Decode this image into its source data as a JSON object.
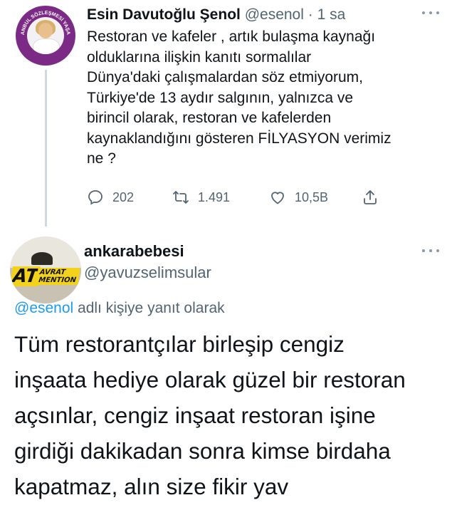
{
  "tweet1": {
    "author_name": "Esin Davutoğlu Şenol",
    "handle": "@esenol",
    "separator": "·",
    "time": "1 sa",
    "text": "Restoran ve kafeler , artık bulaşma kaynağı\nolduklarına ilişkin kanıtı sormalılar\nDünya'daki çalışmalardan söz etmiyorum,\nTürkiye'de 13 aydır salgının, yalnızca ve\nbirincil olarak, restoran ve kafelerden\nkaynaklandığını gösteren FİLYASYON verimiz\nne ?",
    "avatar_ring_text": "İSTANBUL SÖZLEŞMESİ YAŞATIR",
    "actions": {
      "reply_icon": "reply-icon",
      "reply_count": "202",
      "retweet_icon": "retweet-icon",
      "retweet_count": "1.491",
      "like_icon": "like-icon",
      "like_count": "10,5B",
      "share_icon": "share-icon"
    }
  },
  "tweet2": {
    "author_name": "ankarabebesi",
    "handle": "@yavuzselimsular",
    "avatar_logo_big": "AT",
    "avatar_logo_small_1": "AVRAT",
    "avatar_logo_small_2": "MENTION",
    "reply_to_handle": "@esenol",
    "reply_to_suffix": " adlı kişiye yanıt olarak",
    "text": "Tüm restorantçılar birleşip cengiz\ninşaata hediye olarak güzel bir restoran\naçsınlar, cengiz inşaat restoran işine\ngirdiği dakikadan sonra kimse birdaha\nkapatmaz, alın size fikir yav"
  },
  "colors": {
    "text": "#0f1419",
    "muted": "#536471",
    "link": "#1d9bf0",
    "thread_line": "#cfd9de"
  }
}
